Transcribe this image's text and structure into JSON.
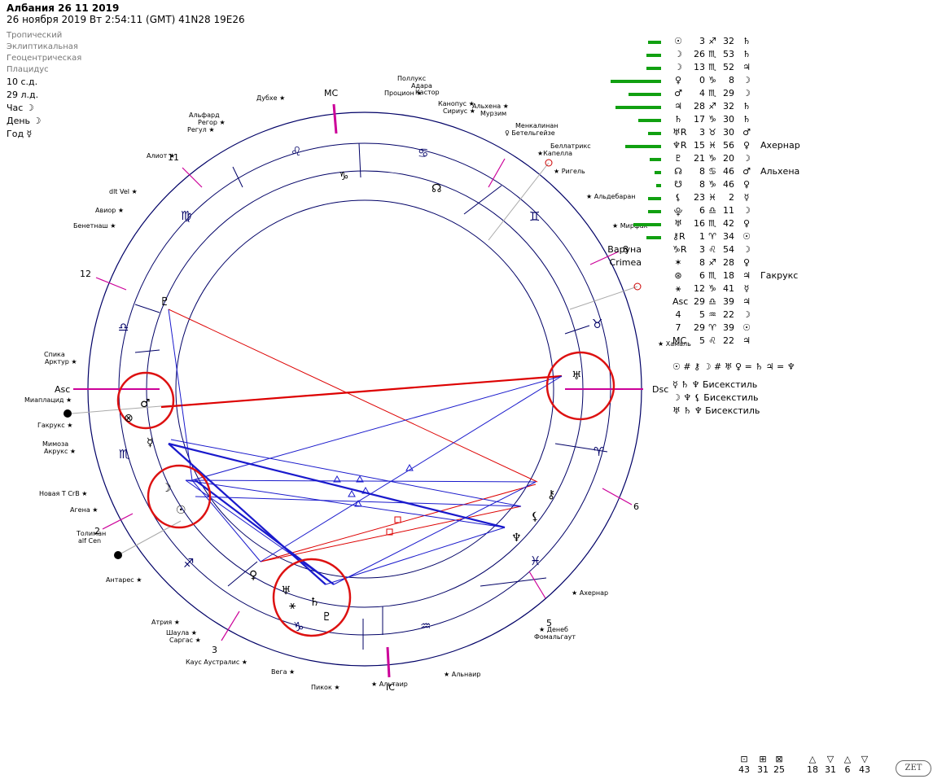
{
  "header": {
    "title": "Албания 26 11 2019",
    "subtitle": "26 ноября 2019  Вт   2:54:11 (GMT) 41N28  19E26"
  },
  "settings": [
    "Тропический",
    "Эклиптикальная",
    "Геоцентрическая",
    "Плацидус"
  ],
  "info": [
    "10 с.д.",
    "29 л.д.",
    "Час ☽",
    "День ☽",
    "Год ☿"
  ],
  "axes": {
    "mc": "MC",
    "ic": "IC",
    "asc": "Asc",
    "dsc": "Dsc"
  },
  "house_numbers": [
    "11",
    "12",
    "2",
    "3",
    "5",
    "6",
    "8"
  ],
  "signs_outer": [
    "♌",
    "♋",
    "♍",
    "♎",
    "♏",
    "♐",
    "♑",
    "♒",
    "♓",
    "♈",
    "♉",
    "♊"
  ],
  "planets_table": [
    {
      "sym": "☉",
      "deg": "3",
      "sign": "♐",
      "min": "32",
      "ruler": "♄",
      "bar": 0.16
    },
    {
      "sym": "☽",
      "deg": "26",
      "sign": "♏",
      "min": "53",
      "ruler": "♄",
      "bar": 0.18
    },
    {
      "sym": "☽",
      "deg": "13",
      "sign": "♏",
      "min": "52",
      "ruler": "♃",
      "bar": 0.18
    },
    {
      "sym": "♀",
      "deg": "0",
      "sign": "♑",
      "min": "8",
      "ruler": "☽",
      "bar": 0.62
    },
    {
      "sym": "♂",
      "deg": "4",
      "sign": "♏",
      "min": "29",
      "ruler": "☽",
      "bar": 0.4
    },
    {
      "sym": "♃",
      "deg": "28",
      "sign": "♐",
      "min": "32",
      "ruler": "♄",
      "bar": 0.56
    },
    {
      "sym": "♄",
      "deg": "17",
      "sign": "♑",
      "min": "30",
      "ruler": "♄",
      "bar": 0.28
    },
    {
      "sym": "♅R",
      "deg": "3",
      "sign": "♉",
      "min": "30",
      "ruler": "♂",
      "bar": 0.16
    },
    {
      "sym": "♆R",
      "deg": "15",
      "sign": "♓",
      "min": "56",
      "ruler": "♀",
      "bar": 0.44,
      "star": "Ахернар"
    },
    {
      "sym": "♇",
      "deg": "21",
      "sign": "♑",
      "min": "20",
      "ruler": "☽",
      "bar": 0.14
    },
    {
      "sym": "☊",
      "deg": "8",
      "sign": "♋",
      "min": "46",
      "ruler": "♂",
      "bar": 0.08,
      "star": "Альхена"
    },
    {
      "sym": "☋",
      "deg": "8",
      "sign": "♑",
      "min": "46",
      "ruler": "♀",
      "bar": 0.06
    },
    {
      "sym": "⚸",
      "deg": "23",
      "sign": "♓",
      "min": "2",
      "ruler": "☿",
      "bar": 0.16
    },
    {
      "sym": "⯓",
      "deg": "6",
      "sign": "♎",
      "min": "11",
      "ruler": "☽",
      "bar": 0.16
    },
    {
      "sym": "♅",
      "deg": "16",
      "sign": "♏",
      "min": "42",
      "ruler": "♀",
      "bar": 0.34
    },
    {
      "sym": "⚷R",
      "deg": "1",
      "sign": "♈",
      "min": "34",
      "ruler": "☉",
      "bar": 0.18
    },
    {
      "sym": "♑R",
      "deg": "3",
      "sign": "♌",
      "min": "54",
      "ruler": "☽",
      "name": "Варуна"
    },
    {
      "sym": "✶",
      "deg": "8",
      "sign": "♐",
      "min": "28",
      "ruler": "♀",
      "name": "Crimea"
    },
    {
      "sym": "⊛",
      "deg": "6",
      "sign": "♏",
      "min": "18",
      "ruler": "♃",
      "star": "Гакрукс"
    },
    {
      "sym": "⚹",
      "deg": "12",
      "sign": "♑",
      "min": "41",
      "ruler": "☿"
    },
    {
      "sym": "Asc",
      "deg": "29",
      "sign": "♎",
      "min": "39",
      "ruler": "♃"
    },
    {
      "sym": "4",
      "deg": "5",
      "sign": "♒",
      "min": "22",
      "ruler": "☽"
    },
    {
      "sym": "7",
      "deg": "29",
      "sign": "♈",
      "min": "39",
      "ruler": "☉"
    },
    {
      "sym": "MC",
      "deg": "5",
      "sign": "♌",
      "min": "22",
      "ruler": "♃"
    }
  ],
  "aspects_text": [
    "☉ # ⚷  ☽ # ♅  ♀ = ♄  ♃ = ♆",
    "☿ ♄ ♆  Бисекстиль",
    "☽ ♆ ⚸  Бисекстиль",
    "♅ ♄ ♆  Бисекстиль"
  ],
  "stats": {
    "squares": [
      "43",
      "31",
      "25"
    ],
    "triangles": [
      "18",
      "31",
      "6",
      "43"
    ]
  },
  "logo": "ZET",
  "stars_outer": [
    "Поллукс",
    "Адара",
    "Кастор",
    "Процион",
    "Канопус",
    "Сириус",
    "Альхена",
    "Мурзим",
    "Дубхе",
    "Альфард",
    "Регор",
    "Регул",
    "Менкалинан",
    "Бетельгейзе",
    "Беллатрикс",
    "Капелла",
    "Ригель",
    "Алиот",
    "dlt Vel",
    "Авиор",
    "Бенетнаш",
    "Альдебаран",
    "Мирфак",
    "Спика",
    "Арктур",
    "Миаплацид",
    "Гакрукс",
    "Мимоза",
    "Акрукс",
    "Новая T CrB",
    "Агена",
    "Толиман",
    "alf Cen",
    "Антарес",
    "Атрия",
    "Шаула",
    "Саргас",
    "Каус Аустралис",
    "Вега",
    "Пикок",
    "Альтаир",
    "Альнаир",
    "Ахернар",
    "Денеб",
    "Фомальгаут",
    "Хамаль"
  ]
}
